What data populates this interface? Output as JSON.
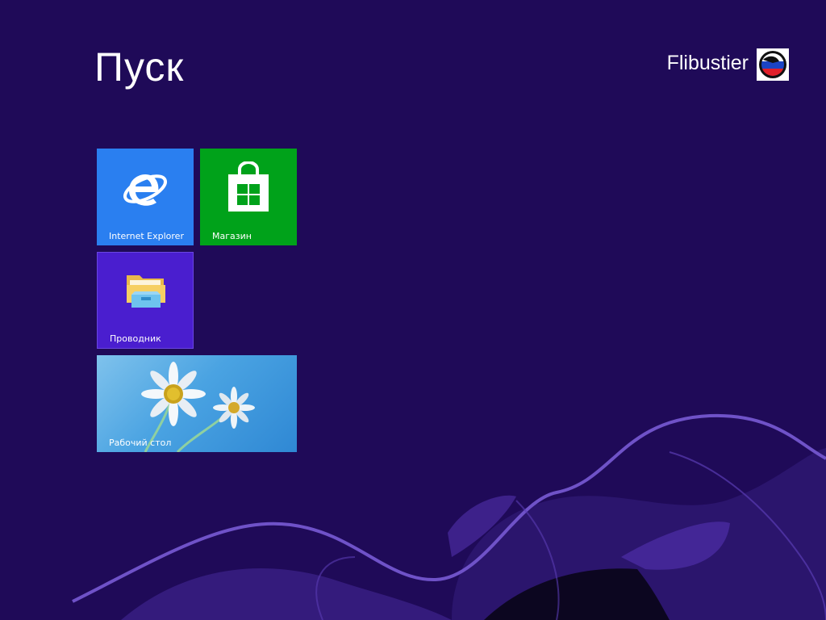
{
  "header": {
    "title": "Пуск",
    "user_name": "Flibustier"
  },
  "tiles": [
    {
      "id": "ie",
      "label": "Internet Explorer",
      "icon": "internet-explorer-icon",
      "color": "#2a7ff0"
    },
    {
      "id": "store",
      "label": "Магазин",
      "icon": "store-bag-icon",
      "color": "#00a21a"
    },
    {
      "id": "explorer",
      "label": "Проводник",
      "icon": "folder-icon",
      "color": "#4a1ecf"
    },
    {
      "id": "desktop",
      "label": "Рабочий стол",
      "icon": "daisy-wallpaper-icon",
      "color": "#4aa3e2"
    }
  ],
  "colors": {
    "background": "#1f0a58",
    "accent_swoosh": "#6f52c8"
  }
}
